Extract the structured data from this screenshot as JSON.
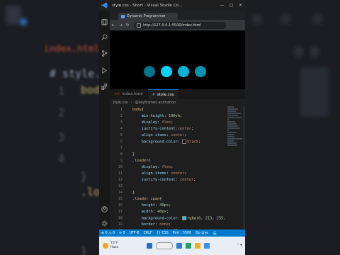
{
  "window": {
    "title": "style.css - Short - Visual Studio Co...",
    "min": "—",
    "max": "▢",
    "close": "✕"
  },
  "browser": {
    "tab_title": "Dynamic Programmer",
    "address": "http://127.0.0.1:5500/index.html",
    "dot_color": "#00d5ff"
  },
  "editor": {
    "tabs": [
      {
        "label": "index.html",
        "icon": "<>",
        "active": false
      },
      {
        "label": "style.css",
        "icon": "#",
        "active": true
      }
    ],
    "breadcrumbs": [
      "style.css",
      "@keyframes animation"
    ]
  },
  "status": {
    "problems": "⊗ 0 ⚠ 0",
    "ports": "⊘ 0",
    "encoding": "UTF-8",
    "eol": "CRLF",
    "language": "{} CSS",
    "port": "Port : 5500",
    "golive": "Go Live"
  },
  "taskbar": {
    "temp": "73°F",
    "condition": "Haze"
  },
  "background": {
    "left_tab": "index.html",
    "left_file": "# style.css",
    "left_code": "bod",
    "left_brace": "}",
    "left_loader": ".lo",
    "left_n1": "1",
    "left_n2": "2",
    "left_n3": "3",
    "left_n4": "4"
  }
}
